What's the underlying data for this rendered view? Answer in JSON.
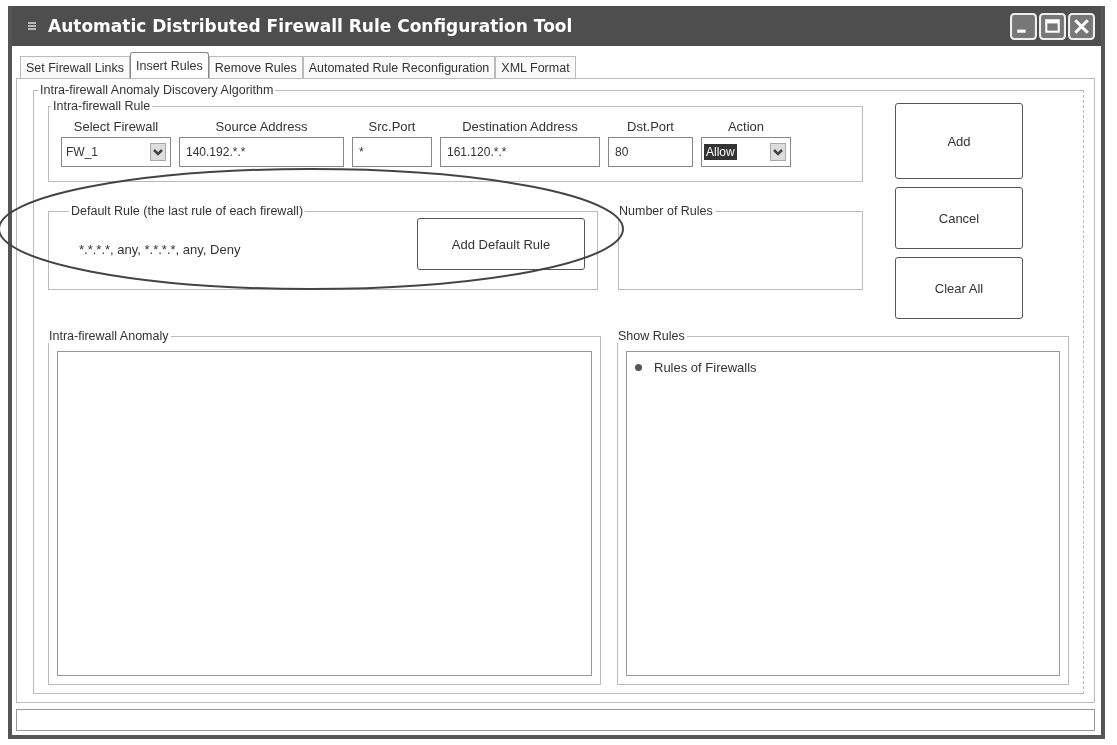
{
  "window": {
    "title": "Automatic Distributed Firewall Rule Configuration Tool"
  },
  "tabs": [
    {
      "label": "Set Firewall Links",
      "selected": false
    },
    {
      "label": "Insert Rules",
      "selected": true
    },
    {
      "label": "Remove Rules",
      "selected": false
    },
    {
      "label": "Automated Rule Reconfiguration",
      "selected": false
    },
    {
      "label": "XML Format",
      "selected": false
    }
  ],
  "panel": {
    "title": "Intra-firewall Anomaly Discovery Algorithm"
  },
  "rule_group": {
    "title": "Intra-firewall Rule",
    "fields": [
      {
        "label": "Select Firewall",
        "kind": "dropdown",
        "value": "FW_1",
        "highlighted": false
      },
      {
        "label": "Source Address",
        "kind": "text",
        "value": "140.192.*.*",
        "highlighted": false
      },
      {
        "label": "Src.Port",
        "kind": "text",
        "value": "*",
        "highlighted": false
      },
      {
        "label": "Destination Address",
        "kind": "text",
        "value": "161.120.*.*",
        "highlighted": false
      },
      {
        "label": "Dst.Port",
        "kind": "text",
        "value": "80",
        "highlighted": false
      },
      {
        "label": "Action",
        "kind": "dropdown",
        "value": "Allow",
        "highlighted": true
      }
    ]
  },
  "buttons": [
    "Add",
    "Cancel",
    "Clear All"
  ],
  "default_rule": {
    "title": "Default Rule (the last rule of each firewall)",
    "rule": "*.*.*.*, any, *.*.*.*, any, Deny",
    "button": "Add Default Rule"
  },
  "number_of_rules": {
    "title": "Number of Rules"
  },
  "anomaly": {
    "title": "Intra-firewall Anomaly"
  },
  "show_rules": {
    "title": "Show Rules",
    "items": [
      {
        "label": "Rules of Firewalls"
      }
    ]
  }
}
